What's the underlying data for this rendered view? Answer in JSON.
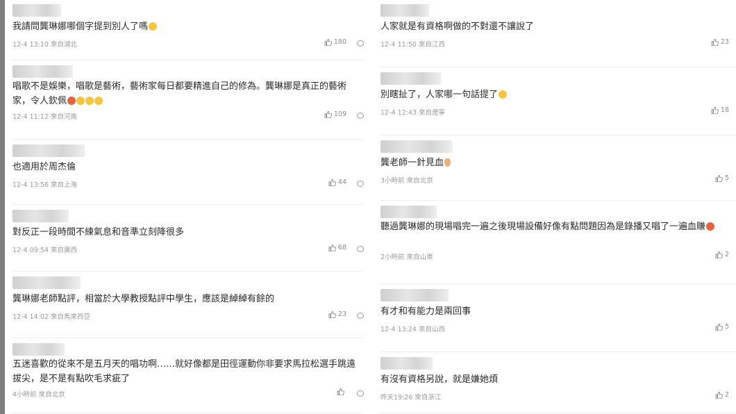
{
  "left_comments": [
    {
      "text": "我請問龔琳娜哪個字提到別人了嗎",
      "emojis": [
        "emoji-face"
      ],
      "time": "12-4 13:10",
      "loc": "來自湖北",
      "likes": "180"
    },
    {
      "text": "唱歌不是娛樂，唱歌是藝術，藝術家每日都要精進自己的修為。龔琳娜是真正的藝術家，令人欽佩",
      "emojis": [
        "emoji-red",
        "emoji-face",
        "emoji-face",
        "emoji-face"
      ],
      "time": "12-4 11:12",
      "loc": "來自河南",
      "likes": "109"
    },
    {
      "text": "也適用於周杰倫",
      "emojis": [],
      "time": "12-4 13:56",
      "loc": "來自上海",
      "likes": "44"
    },
    {
      "text": "對反正一段時間不練氣息和音準立刻降很多",
      "emojis": [],
      "time": "12-4 09:54",
      "loc": "來自廣西",
      "likes": "68"
    },
    {
      "text": "龔琳娜老師點評，相當於大學教授點評中學生，應該是綽綽有餘的",
      "emojis": [],
      "time": "12-4 14:02",
      "loc": "來自馬來西亞",
      "likes": "23"
    },
    {
      "text": "五迷喜歡的從來不是五月天的唱功啊……就好像都是田徑運動你非要求馬拉松選手跳遠拔尖，是不是有點吹毛求疵了",
      "emojis": [],
      "time": "4小時前",
      "loc": "來自北京",
      "likes": ""
    }
  ],
  "right_comments": [
    {
      "text": "人家就是有資格啊做的不對還不讓說了",
      "emojis": [],
      "time": "12-4 11:50",
      "loc": "來自江西",
      "likes": "23"
    },
    {
      "text": "別瞎扯了，人家哪一句話提了",
      "emojis": [
        "emoji-face"
      ],
      "time": "12-4 12:43",
      "loc": "來自遼寧",
      "likes": "18"
    },
    {
      "text": "龔老師一針見血",
      "emojis": [
        "emoji-hand"
      ],
      "time": "3小時前",
      "loc": "來自北京",
      "likes": "5"
    },
    {
      "text": "聽過龔琳娜的現場唱完一遍之後現場設備好像有點問題因為是錄播又唱了一遍血賺",
      "emojis": [
        "emoji-red"
      ],
      "time": "2小時前",
      "loc": "來自山東",
      "likes": "2"
    },
    {
      "text": "有才和有能力是兩回事",
      "emojis": [],
      "time": "12-4 13:24",
      "loc": "來自山西",
      "likes": "5"
    },
    {
      "text": "有沒有資格另說，就是嫌她煩",
      "emojis": [],
      "time": "昨天19:26",
      "loc": "來自浙江",
      "likes": "2"
    }
  ],
  "colors": {
    "text": "#2a2a2a",
    "meta": "#9a9a9a",
    "separator": "#ececec",
    "avatar_blur": "#d6d6d6"
  }
}
